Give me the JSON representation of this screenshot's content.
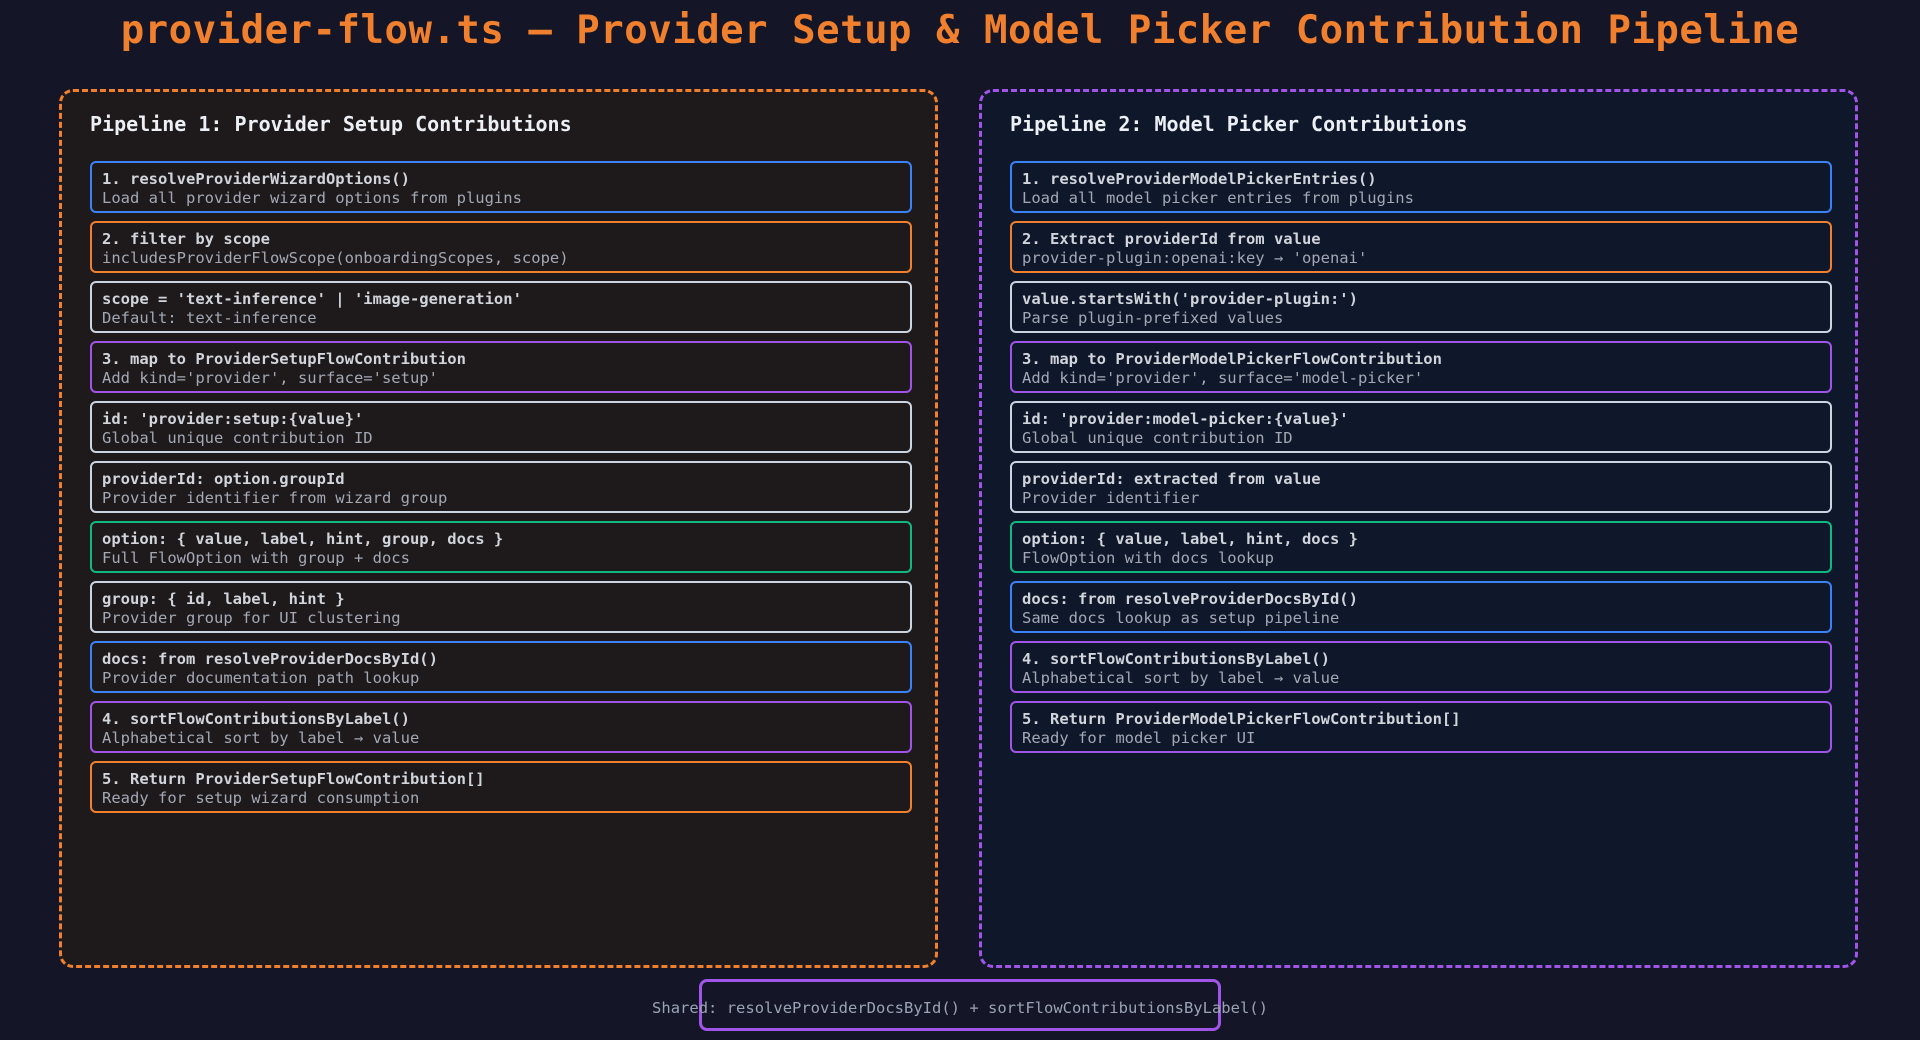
{
  "title": "provider-flow.ts — Provider Setup & Model Picker Contribution Pipeline",
  "colors": {
    "blue": "#3b82f6",
    "orange": "#f0802d",
    "gray": "#cbd5e1",
    "purple": "#a055e8",
    "green": "#10b981"
  },
  "pipelines": [
    {
      "title": "Pipeline 1: Provider Setup Contributions",
      "steps": [
        {
          "l1": "1. resolveProviderWizardOptions()",
          "l2": "Load all provider wizard options from plugins",
          "color": "blue"
        },
        {
          "l1": "2. filter by scope",
          "l2": "includesProviderFlowScope(onboardingScopes, scope)",
          "color": "orange"
        },
        {
          "l1": "scope = 'text-inference' | 'image-generation'",
          "l2": "Default: text-inference",
          "color": "gray"
        },
        {
          "l1": "3. map to ProviderSetupFlowContribution",
          "l2": "Add kind='provider', surface='setup'",
          "color": "purple"
        },
        {
          "l1": "id: 'provider:setup:{value}'",
          "l2": "Global unique contribution ID",
          "color": "gray"
        },
        {
          "l1": "providerId: option.groupId",
          "l2": "Provider identifier from wizard group",
          "color": "gray"
        },
        {
          "l1": "option: { value, label, hint, group, docs }",
          "l2": "Full FlowOption with group + docs",
          "color": "green"
        },
        {
          "l1": "group: { id, label, hint }",
          "l2": "Provider group for UI clustering",
          "color": "gray"
        },
        {
          "l1": "docs: from resolveProviderDocsById()",
          "l2": "Provider documentation path lookup",
          "color": "blue"
        },
        {
          "l1": "4. sortFlowContributionsByLabel()",
          "l2": "Alphabetical sort by label → value",
          "color": "purple"
        },
        {
          "l1": "5. Return ProviderSetupFlowContribution[]",
          "l2": "Ready for setup wizard consumption",
          "color": "orange"
        }
      ]
    },
    {
      "title": "Pipeline 2: Model Picker Contributions",
      "steps": [
        {
          "l1": "1. resolveProviderModelPickerEntries()",
          "l2": "Load all model picker entries from plugins",
          "color": "blue"
        },
        {
          "l1": "2. Extract providerId from value",
          "l2": "provider-plugin:openai:key → 'openai'",
          "color": "orange"
        },
        {
          "l1": "value.startsWith('provider-plugin:')",
          "l2": "Parse plugin-prefixed values",
          "color": "gray"
        },
        {
          "l1": "3. map to ProviderModelPickerFlowContribution",
          "l2": "Add kind='provider', surface='model-picker'",
          "color": "purple"
        },
        {
          "l1": "id: 'provider:model-picker:{value}'",
          "l2": "Global unique contribution ID",
          "color": "gray"
        },
        {
          "l1": "providerId: extracted from value",
          "l2": "Provider identifier",
          "color": "gray"
        },
        {
          "l1": "option: { value, label, hint, docs }",
          "l2": "FlowOption with docs lookup",
          "color": "green"
        },
        {
          "l1": "docs: from resolveProviderDocsById()",
          "l2": "Same docs lookup as setup pipeline",
          "color": "blue"
        },
        {
          "l1": "4. sortFlowContributionsByLabel()",
          "l2": "Alphabetical sort by label → value",
          "color": "purple"
        },
        {
          "l1": "5. Return ProviderModelPickerFlowContribution[]",
          "l2": "Ready for model picker UI",
          "color": "purple"
        }
      ]
    }
  ],
  "footer": "Shared: resolveProviderDocsById() + sortFlowContributionsByLabel()"
}
